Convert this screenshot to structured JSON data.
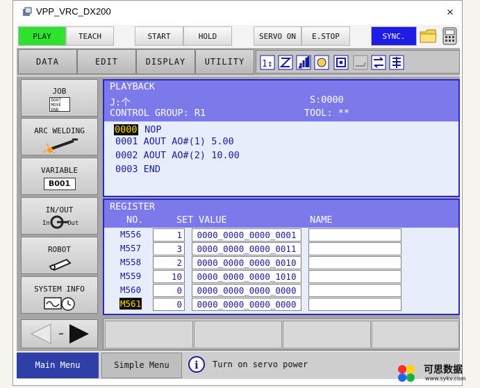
{
  "window": {
    "title": "VPP_VRC_DX200",
    "close_label": "×"
  },
  "toolbar": {
    "buttons": [
      "PLAY",
      "TEACH",
      "START",
      "HOLD",
      "SERVO ON",
      "E.STOP",
      "SYNC."
    ],
    "icons": [
      "folder-icon",
      "controller-icon"
    ]
  },
  "menu": {
    "items": [
      "DATA",
      "EDIT",
      "DISPLAY",
      "UTILITY"
    ]
  },
  "side_menu": {
    "job": {
      "label": "JOB",
      "icon_lines": [
        "DOUT",
        "MOVE",
        "END"
      ]
    },
    "arc": {
      "label": "ARC WELDING"
    },
    "variable": {
      "label": "VARIABLE",
      "value": "B001"
    },
    "inout": {
      "label": "IN/OUT",
      "in_label": "In",
      "out_label": "Out"
    },
    "robot": {
      "label": "ROBOT"
    },
    "system": {
      "label": "SYSTEM INFO"
    }
  },
  "playback": {
    "title": "PLAYBACK",
    "job_line": "J:个",
    "step": "S:0000",
    "control_group": "CONTROL GROUP: R1",
    "tool": "TOOL: **",
    "lines": [
      {
        "num": "0000",
        "text": "NOP"
      },
      {
        "num": "0001",
        "text": "AOUT AO#(1) 5.00"
      },
      {
        "num": "0002",
        "text": "AOUT AO#(2) 10.00"
      },
      {
        "num": "0003",
        "text": "END"
      }
    ]
  },
  "register": {
    "title": "REGISTER",
    "headers": {
      "no": "NO.",
      "set": "SET",
      "value": "VALUE",
      "name": "NAME"
    },
    "rows": [
      {
        "no": "M556",
        "set": "1",
        "value": "0000_0000_0000_0001",
        "name": ""
      },
      {
        "no": "M557",
        "set": "3",
        "value": "0000_0000_0000_0011",
        "name": ""
      },
      {
        "no": "M558",
        "set": "2",
        "value": "0000_0000_0000_0010",
        "name": ""
      },
      {
        "no": "M559",
        "set": "10",
        "value": "0000_0000_0000_1010",
        "name": ""
      },
      {
        "no": "M560",
        "set": "0",
        "value": "0000_0000_0000_0000",
        "name": ""
      },
      {
        "no": "M561",
        "set": "0",
        "value": "0000_0000_0000_0000",
        "name": ""
      }
    ]
  },
  "status": {
    "main_menu": "Main Menu",
    "simple_menu": "Simple Menu",
    "message": "Turn on servo power"
  },
  "watermark": {
    "text": "可思数据",
    "url": "www.sykv.com"
  },
  "colors": {
    "play": "#2ee22e",
    "sync": "#1d1de6",
    "panel_header": "#7b79ec",
    "main_menu": "#2f3fa8"
  }
}
